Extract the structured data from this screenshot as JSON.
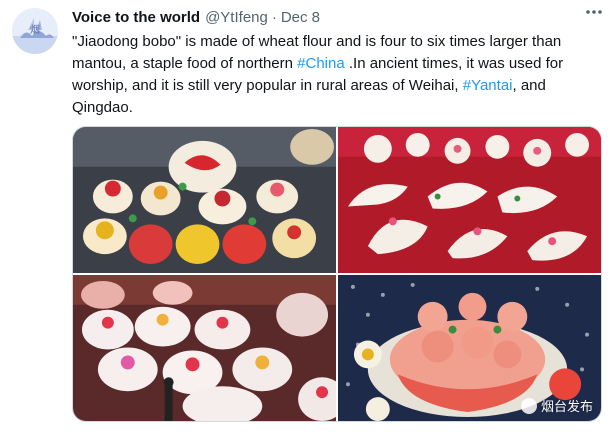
{
  "tweet": {
    "display_name": "Voice to the world",
    "handle": "@YtIfeng",
    "separator": "·",
    "date": "Dec 8",
    "text_part1": "\"Jiaodong bobo\" is made of wheat flour and is four to six times larger than mantou, a staple food of northern ",
    "hashtag1": "#China",
    "text_part2": " .In ancient times, it was used for worship, and it is still very popular in rural areas of Weihai, ",
    "hashtag2": "#Yantai",
    "text_part3": ", and Qingdao.",
    "more_icon": "ellipsis-icon",
    "link_color": "#1d9bf0"
  },
  "media": {
    "photos": [
      {
        "subject": "steamed-buns-on-rack"
      },
      {
        "subject": "animal-buns-on-red-cloth"
      },
      {
        "subject": "flower-buns-on-table"
      },
      {
        "subject": "decorated-bun-platter"
      }
    ],
    "watermark": "烟台发布"
  }
}
